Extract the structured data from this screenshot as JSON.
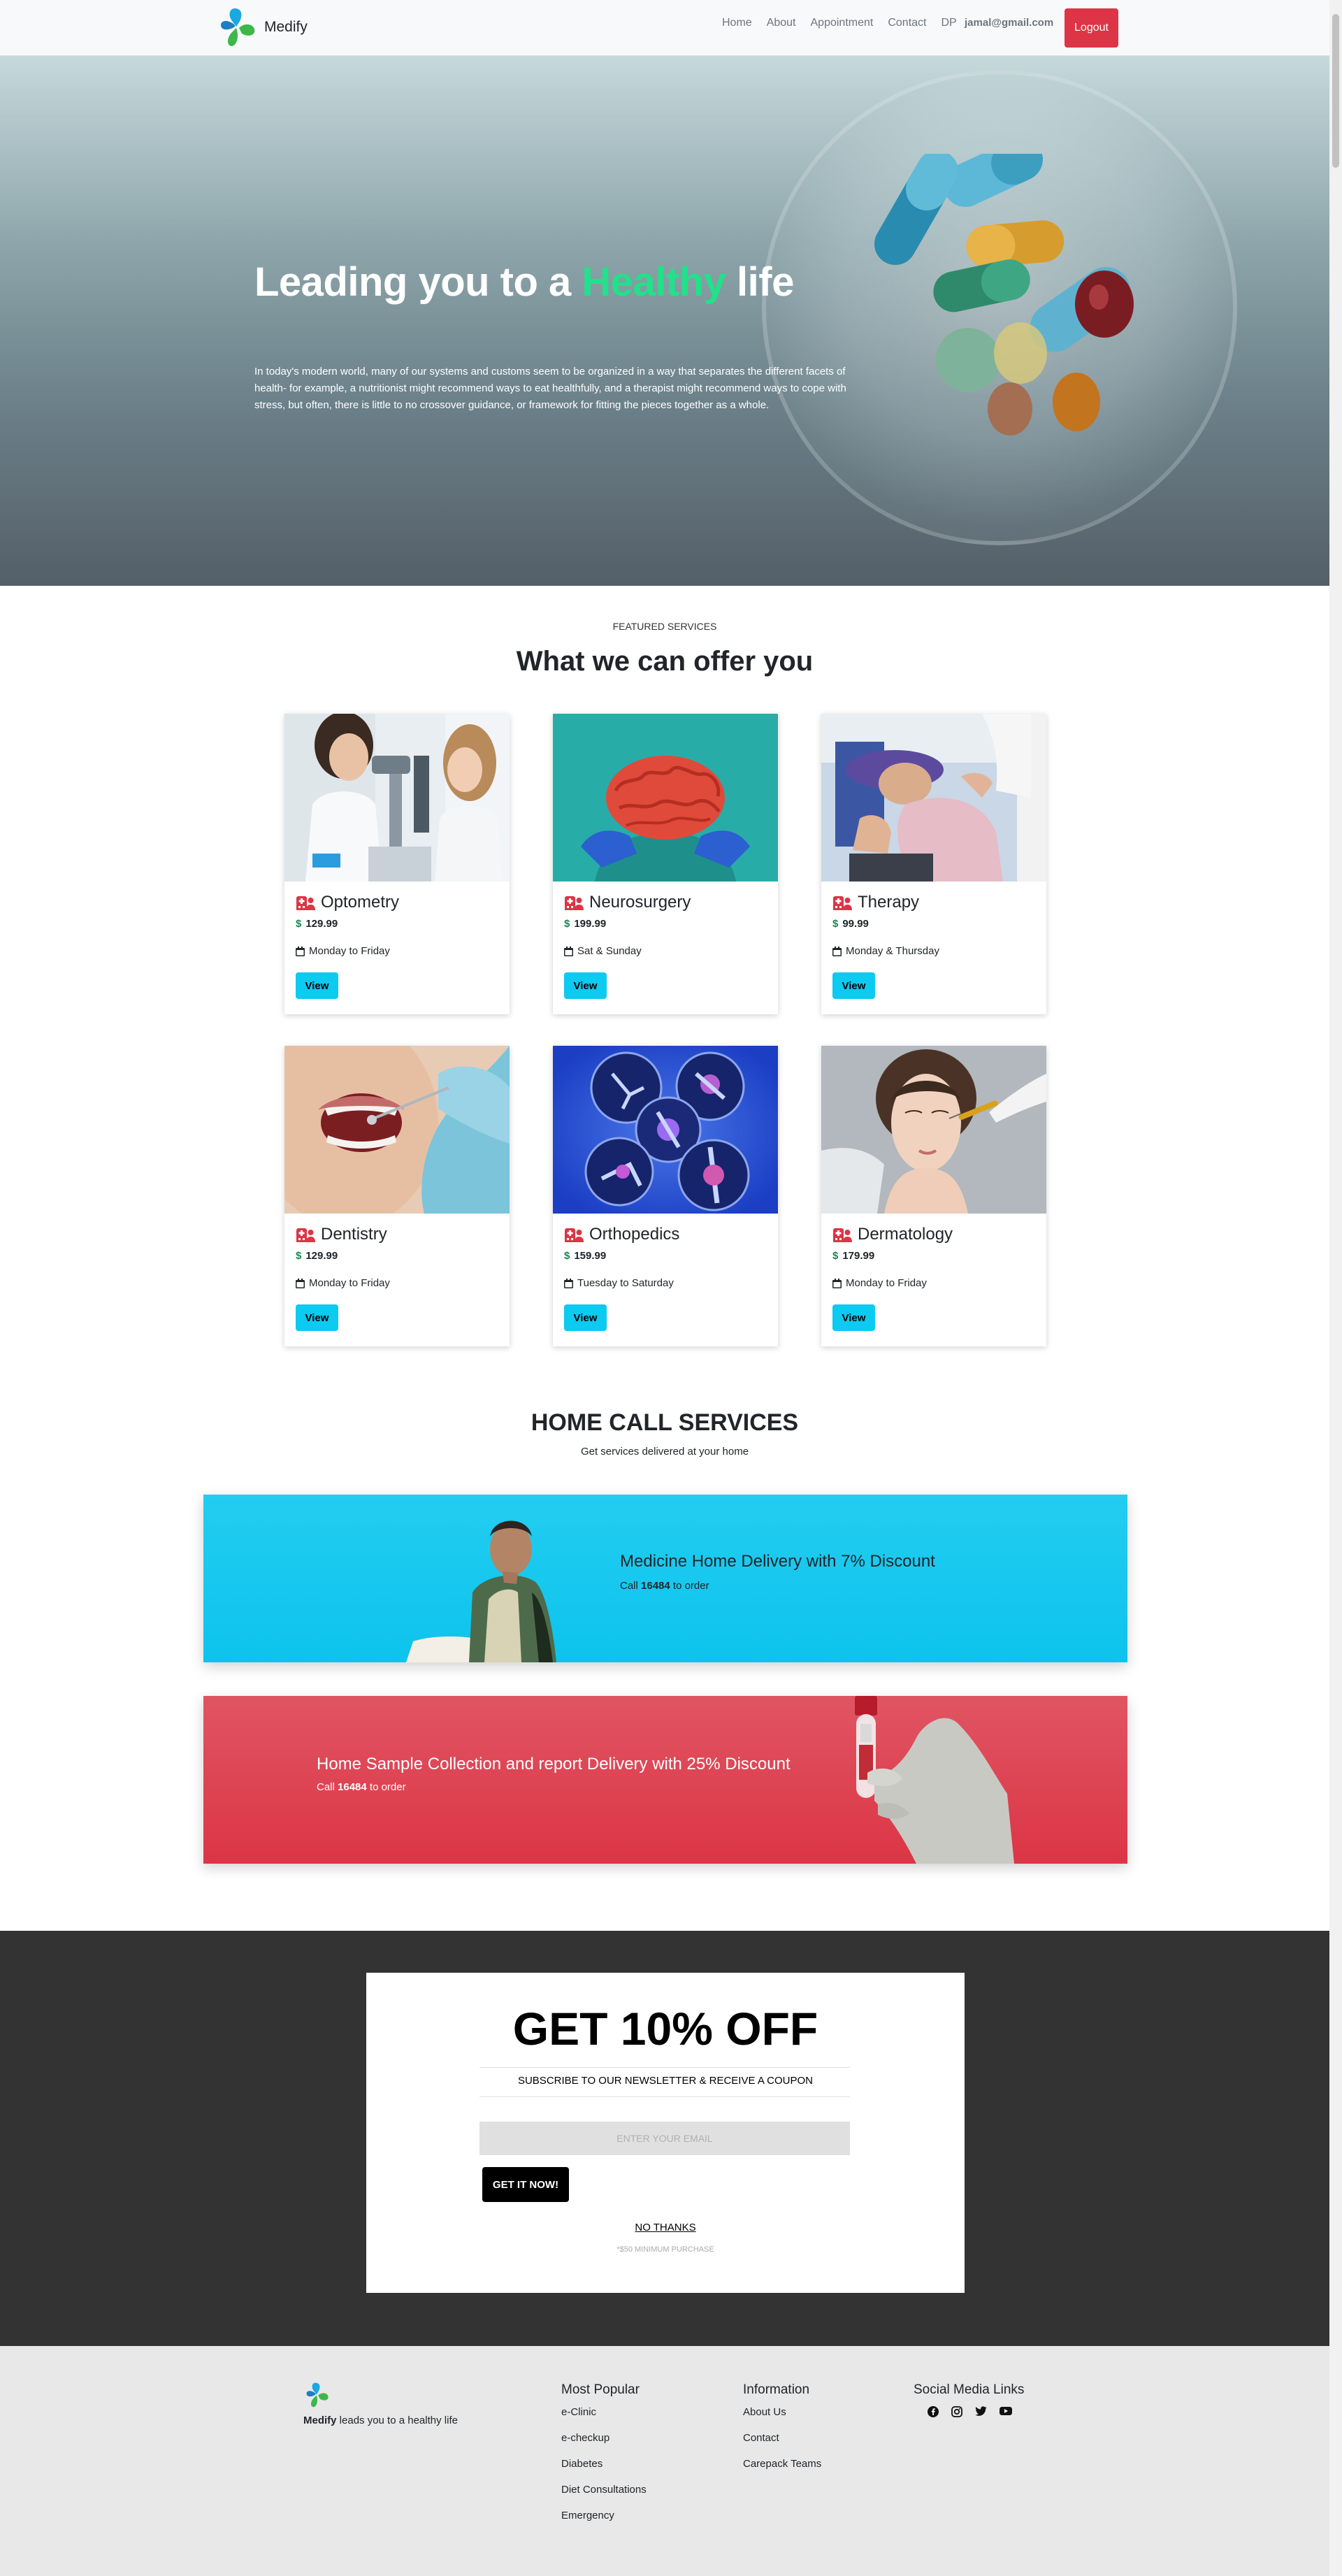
{
  "nav": {
    "brand": "Medify",
    "links": [
      "Home",
      "About",
      "Appointment",
      "Contact",
      "DP"
    ],
    "user_email": "jamal@gmail.com",
    "logout_label": "Logout"
  },
  "hero": {
    "title_before": "Leading you to a ",
    "title_accent": "Healthy",
    "title_after": " life",
    "description": "In today's modern world, many of our systems and customs seem to be organized in a way that separates the different facets of health- for example, a nutritionist might recommend ways to eat healthfully, and a therapist might recommend ways to cope with stress, but often, there is little to no crossover guidance, or framework for fitting the pieces together as a whole."
  },
  "featured": {
    "eyebrow": "FEATURED SERVICES",
    "title": "What we can offer you",
    "currency_symbol": "$",
    "view_label": "View",
    "services": [
      {
        "name": "Optometry",
        "price": "129.99",
        "days": "Monday to Friday",
        "accent": "#dc3545"
      },
      {
        "name": "Neurosurgery",
        "price": "199.99",
        "days": "Sat & Sunday",
        "accent": "#dc3545"
      },
      {
        "name": "Therapy",
        "price": "99.99",
        "days": "Monday & Thursday",
        "accent": "#dc3545"
      },
      {
        "name": "Dentistry",
        "price": "129.99",
        "days": "Monday to Friday",
        "accent": "#dc3545"
      },
      {
        "name": "Orthopedics",
        "price": "159.99",
        "days": "Tuesday to Saturday",
        "accent": "#dc3545"
      },
      {
        "name": "Dermatology",
        "price": "179.99",
        "days": "Monday to Friday",
        "accent": "#dc3545"
      }
    ]
  },
  "home_call": {
    "title": "HOME CALL SERVICES",
    "subtitle": "Get services delivered at your home",
    "banners": [
      {
        "heading": "Medicine Home Delivery with 7% Discount",
        "call_prefix": "Call ",
        "phone": "16484",
        "call_suffix": " to order",
        "color": "#0dcaf0"
      },
      {
        "heading": "Home Sample Collection and report Delivery with 25% Discount",
        "call_prefix": "Call ",
        "phone": "16484",
        "call_suffix": " to order",
        "color": "#dc3545"
      }
    ]
  },
  "newsletter": {
    "heading": "GET 10% OFF",
    "subheading": "SUBSCRIBE TO OUR NEWSLETTER & RECEIVE A COUPON",
    "email_placeholder": "ENTER YOUR EMAIL",
    "button_label": "GET IT NOW!",
    "no_thanks": "NO THANKS",
    "fine_print": "*$50 MINIMUM PURCHASE"
  },
  "footer": {
    "brand": "Medify",
    "tagline": " leads you to a healthy life",
    "columns": [
      {
        "title": "Most Popular",
        "links": [
          "e-Clinic",
          "e-checkup",
          "Diabetes",
          "Diet Consultations",
          "Emergency"
        ]
      },
      {
        "title": "Information",
        "links": [
          "About Us",
          "Contact",
          "Carepack Teams"
        ]
      }
    ],
    "social_title": "Social Media Links",
    "social_icons": [
      "facebook-icon",
      "instagram-icon",
      "twitter-icon",
      "youtube-icon"
    ]
  }
}
